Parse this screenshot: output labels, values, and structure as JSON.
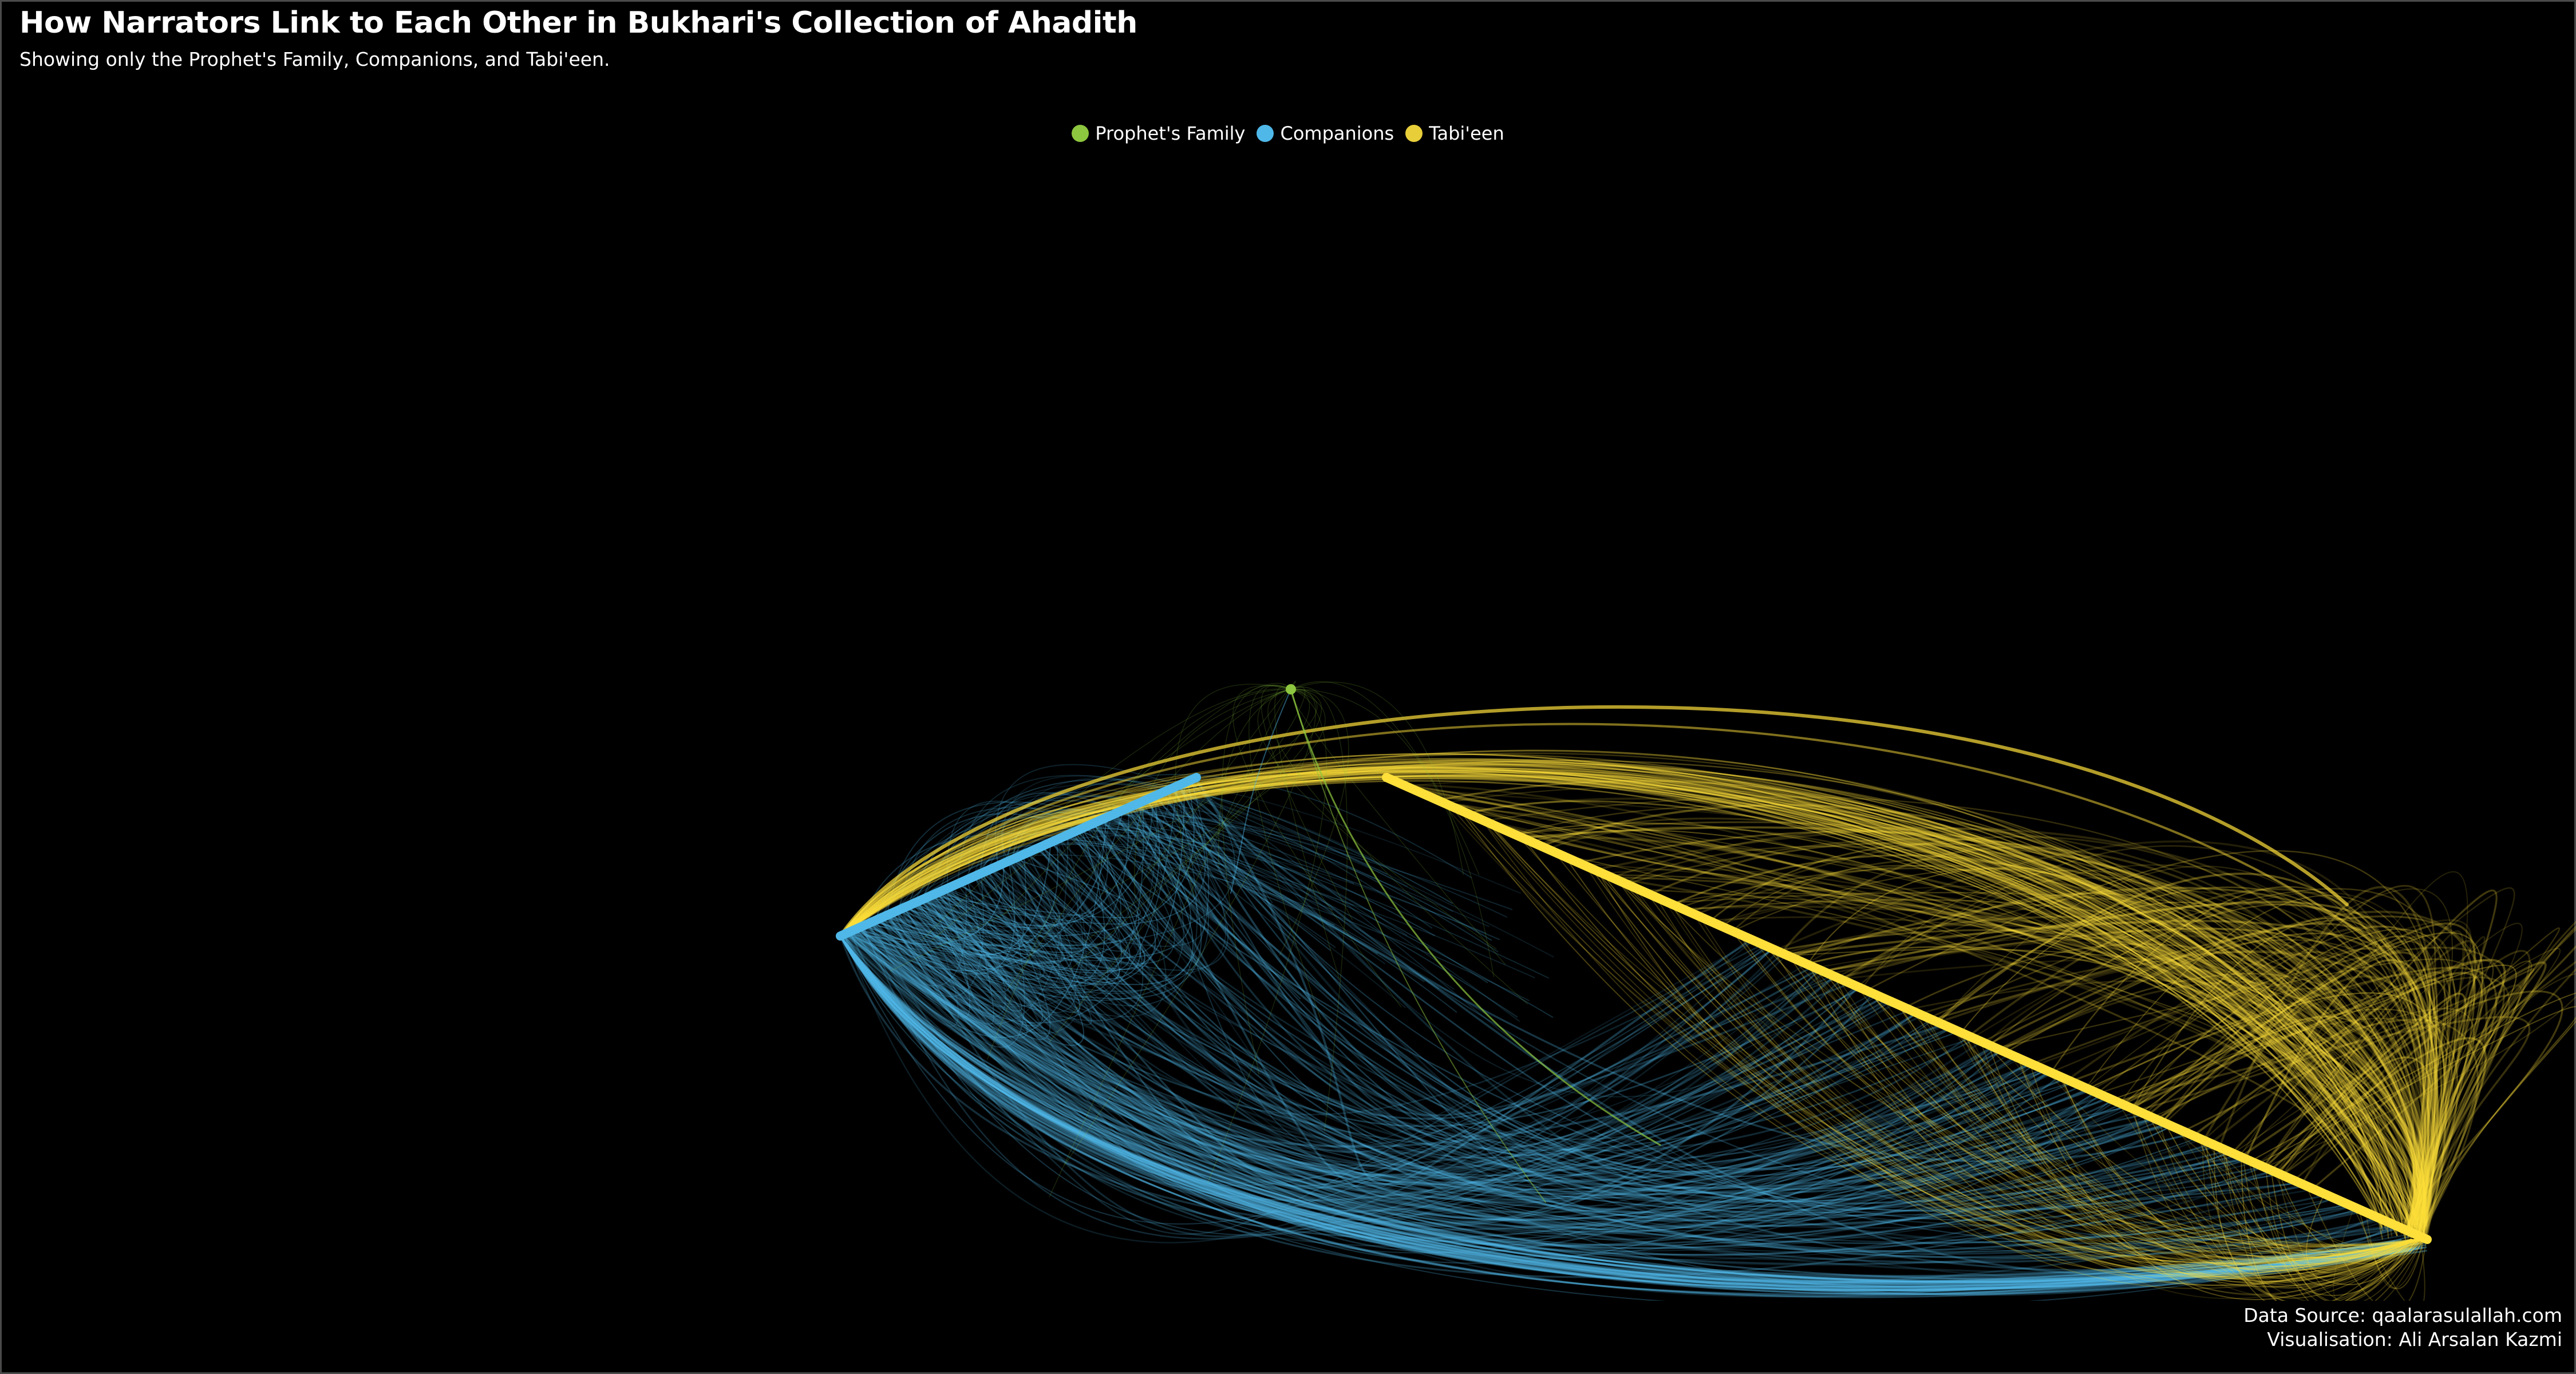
{
  "header": {
    "title": "How Narrators Link to Each Other in Bukhari's Collection of Ahadith",
    "subtitle": "Showing only the Prophet's Family, Companions, and Tabi'een."
  },
  "legend": {
    "items": [
      {
        "label": "Prophet's Family",
        "color": "#8dc63f"
      },
      {
        "label": "Companions",
        "color": "#4fb8e8"
      },
      {
        "label": "Tabi'een",
        "color": "#e8cf3a"
      }
    ]
  },
  "diagram": {
    "type": "hive plot",
    "axes": [
      {
        "group": "Prophet's Family",
        "color": "#8dc63f"
      },
      {
        "group": "Companions",
        "color": "#4fb8e8"
      },
      {
        "group": "Tabi'een",
        "color": "#ffe03a"
      }
    ]
  },
  "footer": {
    "source": "Data Source: qaalarasulallah.com",
    "credit": "Visualisation: Ali Arsalan Kazmi"
  }
}
